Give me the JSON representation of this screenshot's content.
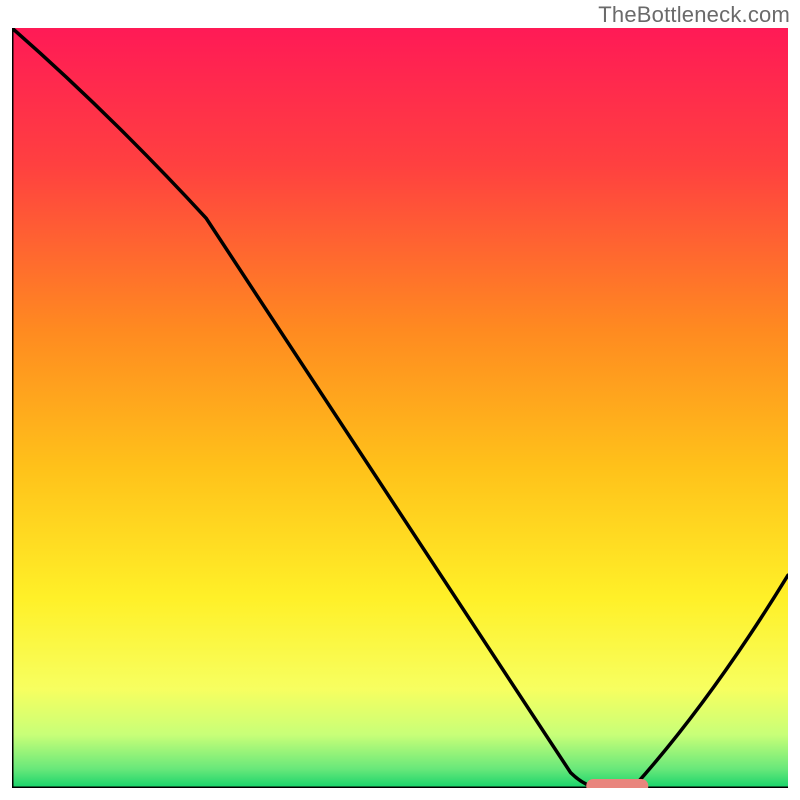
{
  "watermark": "TheBottleneck.com",
  "chart_data": {
    "type": "line",
    "title": "",
    "xlabel": "",
    "ylabel": "",
    "xlim": [
      0,
      100
    ],
    "ylim": [
      0,
      100
    ],
    "grid": false,
    "series": [
      {
        "name": "curve",
        "x": [
          0,
          25,
          72,
          76,
          80,
          100
        ],
        "y": [
          100,
          75,
          2,
          0,
          0,
          28
        ]
      }
    ],
    "marker": {
      "name": "highlight-segment",
      "x_range": [
        74,
        82
      ],
      "y": 0,
      "color": "#e9857d"
    },
    "background_gradient": {
      "stops": [
        {
          "t": 0.0,
          "color": "#ff1a56"
        },
        {
          "t": 0.18,
          "color": "#ff4040"
        },
        {
          "t": 0.4,
          "color": "#ff8b20"
        },
        {
          "t": 0.58,
          "color": "#ffc21a"
        },
        {
          "t": 0.75,
          "color": "#fff028"
        },
        {
          "t": 0.87,
          "color": "#f7ff60"
        },
        {
          "t": 0.93,
          "color": "#c8ff78"
        },
        {
          "t": 0.975,
          "color": "#68e87a"
        },
        {
          "t": 1.0,
          "color": "#17d36b"
        }
      ]
    }
  }
}
